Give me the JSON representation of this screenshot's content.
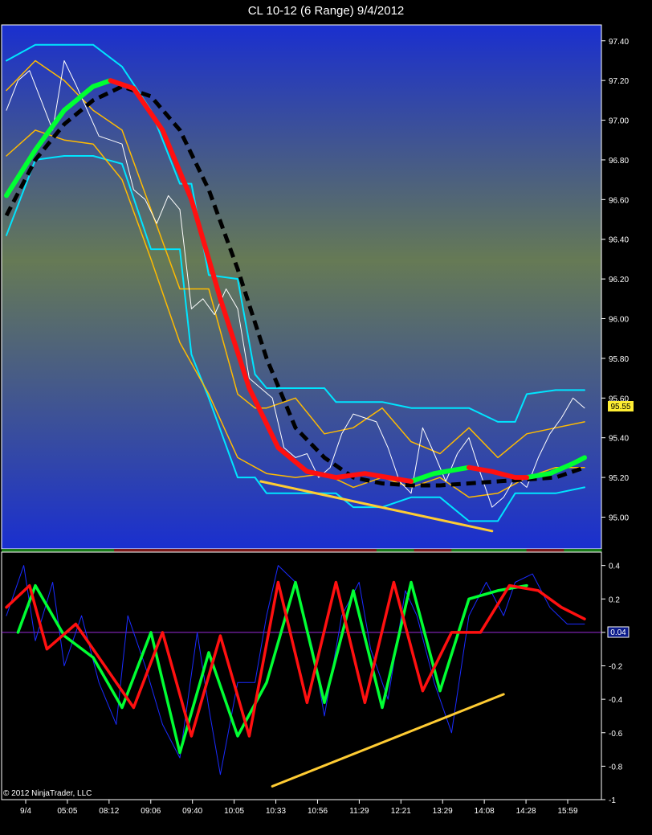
{
  "window": {
    "title": "CL 10-12 (6 Range)  9/4/2012",
    "copyright": "© 2012 NinjaTrader, LLC"
  },
  "chart_data": [
    {
      "type": "line",
      "name": "price-panel",
      "ylim": [
        94.84,
        97.48
      ],
      "y_ticks": [
        "97.40",
        "97.20",
        "97.00",
        "96.80",
        "96.60",
        "96.40",
        "96.20",
        "96.00",
        "95.80",
        "95.60",
        "95.40",
        "95.20",
        "95.00"
      ],
      "last_price_label": "95.55",
      "background": [
        "#1a2fcf",
        "#667a55",
        "#1a2fcf"
      ],
      "series": [
        {
          "color": "#ffffff",
          "role": "price",
          "x": [
            0,
            0.02,
            0.04,
            0.06,
            0.08,
            0.1,
            0.12,
            0.14,
            0.16,
            0.18,
            0.2,
            0.22,
            0.24,
            0.26,
            0.28,
            0.3,
            0.32,
            0.34,
            0.36,
            0.38,
            0.4,
            0.42,
            0.44,
            0.46,
            0.48,
            0.5,
            0.52,
            0.54,
            0.56,
            0.58,
            0.6,
            0.62,
            0.64,
            0.66,
            0.68,
            0.7,
            0.72,
            0.74,
            0.76,
            0.78,
            0.8,
            0.82,
            0.84,
            0.86,
            0.88,
            0.9,
            0.92,
            0.94,
            0.96,
            0.98,
            1
          ],
          "y": [
            97.05,
            97.2,
            97.25,
            97.1,
            96.95,
            97.3,
            97.18,
            97.05,
            96.92,
            96.9,
            96.88,
            96.65,
            96.6,
            96.48,
            96.62,
            96.55,
            96.05,
            96.1,
            96.02,
            96.15,
            96.05,
            95.7,
            95.65,
            95.6,
            95.35,
            95.3,
            95.32,
            95.2,
            95.25,
            95.42,
            95.52,
            95.5,
            95.48,
            95.35,
            95.18,
            95.12,
            95.45,
            95.32,
            95.18,
            95.32,
            95.4,
            95.22,
            95.05,
            95.1,
            95.2,
            95.15,
            95.3,
            95.42,
            95.5,
            95.6,
            95.55
          ]
        },
        {
          "color": "#00ff33",
          "role": "smooth-average-up",
          "x": [
            0,
            0.05,
            0.1,
            0.15,
            0.18
          ],
          "y": [
            96.62,
            96.85,
            97.05,
            97.17,
            97.2
          ]
        },
        {
          "color": "#ff1010",
          "role": "smooth-average-down",
          "x": [
            0.18,
            0.22,
            0.27,
            0.32,
            0.37,
            0.42,
            0.47,
            0.52,
            0.57,
            0.62,
            0.66,
            0.7
          ],
          "y": [
            97.2,
            97.16,
            96.95,
            96.6,
            96.1,
            95.65,
            95.35,
            95.23,
            95.2,
            95.22,
            95.2,
            95.18
          ]
        },
        {
          "color": "#00ff33",
          "role": "smooth-average-up",
          "x": [
            0.7,
            0.74,
            0.78,
            0.8
          ],
          "y": [
            95.18,
            95.22,
            95.24,
            95.25
          ]
        },
        {
          "color": "#ff1010",
          "role": "smooth-average-down",
          "x": [
            0.8,
            0.84,
            0.88,
            0.9
          ],
          "y": [
            95.25,
            95.23,
            95.2,
            95.2
          ]
        },
        {
          "color": "#00ff33",
          "role": "smooth-average-up",
          "x": [
            0.9,
            0.94,
            0.98,
            1
          ],
          "y": [
            95.2,
            95.22,
            95.27,
            95.3
          ]
        },
        {
          "color": "#000000",
          "role": "slow-average-dashed",
          "x": [
            0,
            0.05,
            0.1,
            0.15,
            0.2,
            0.25,
            0.3,
            0.35,
            0.4,
            0.45,
            0.5,
            0.55,
            0.6,
            0.65,
            0.7,
            0.75,
            0.8,
            0.85,
            0.9,
            0.95,
            1
          ],
          "y": [
            96.52,
            96.8,
            96.98,
            97.1,
            97.17,
            97.12,
            96.95,
            96.65,
            96.25,
            95.8,
            95.45,
            95.3,
            95.2,
            95.17,
            95.16,
            95.16,
            95.17,
            95.18,
            95.19,
            95.2,
            95.25
          ]
        },
        {
          "color": "#00e5ff",
          "role": "upper-channel",
          "x": [
            0,
            0.05,
            0.1,
            0.15,
            0.2,
            0.25,
            0.3,
            0.32,
            0.35,
            0.4,
            0.43,
            0.45,
            0.5,
            0.55,
            0.57,
            0.6,
            0.65,
            0.7,
            0.75,
            0.8,
            0.85,
            0.88,
            0.9,
            0.95,
            1
          ],
          "y": [
            97.3,
            97.38,
            97.38,
            97.38,
            97.27,
            97.05,
            96.68,
            96.68,
            96.22,
            96.2,
            95.72,
            95.65,
            95.65,
            95.65,
            95.58,
            95.58,
            95.58,
            95.55,
            95.55,
            95.55,
            95.48,
            95.48,
            95.62,
            95.64,
            95.64
          ]
        },
        {
          "color": "#00e5ff",
          "role": "lower-channel",
          "x": [
            0,
            0.05,
            0.1,
            0.15,
            0.2,
            0.25,
            0.3,
            0.32,
            0.35,
            0.4,
            0.43,
            0.45,
            0.5,
            0.55,
            0.57,
            0.6,
            0.65,
            0.7,
            0.75,
            0.8,
            0.85,
            0.88,
            0.9,
            0.95,
            1
          ],
          "y": [
            96.42,
            96.8,
            96.82,
            96.82,
            96.78,
            96.35,
            96.35,
            95.82,
            95.6,
            95.2,
            95.2,
            95.12,
            95.12,
            95.12,
            95.12,
            95.05,
            95.05,
            95.1,
            95.1,
            94.98,
            94.98,
            95.12,
            95.12,
            95.12,
            95.15
          ]
        },
        {
          "color": "#ffbb00",
          "role": "inner-upper",
          "x": [
            0,
            0.05,
            0.1,
            0.15,
            0.2,
            0.25,
            0.3,
            0.35,
            0.4,
            0.43,
            0.45,
            0.5,
            0.55,
            0.6,
            0.65,
            0.7,
            0.75,
            0.8,
            0.85,
            0.9,
            0.95,
            1
          ],
          "y": [
            97.15,
            97.3,
            97.2,
            97.05,
            96.95,
            96.55,
            96.15,
            96.15,
            95.62,
            95.55,
            95.55,
            95.6,
            95.42,
            95.45,
            95.55,
            95.38,
            95.32,
            95.45,
            95.3,
            95.42,
            95.45,
            95.48
          ]
        },
        {
          "color": "#ffbb00",
          "role": "inner-lower",
          "x": [
            0,
            0.05,
            0.1,
            0.15,
            0.2,
            0.25,
            0.3,
            0.35,
            0.4,
            0.45,
            0.5,
            0.55,
            0.6,
            0.65,
            0.7,
            0.75,
            0.8,
            0.85,
            0.9,
            0.95,
            1
          ],
          "y": [
            96.82,
            96.95,
            96.9,
            96.88,
            96.7,
            96.3,
            95.88,
            95.62,
            95.3,
            95.22,
            95.2,
            95.22,
            95.15,
            95.2,
            95.15,
            95.2,
            95.1,
            95.12,
            95.2,
            95.25,
            95.25
          ]
        },
        {
          "color": "#ffcc33",
          "role": "trend-line",
          "x": [
            0.44,
            0.84
          ],
          "y": [
            95.18,
            94.93
          ]
        }
      ]
    },
    {
      "type": "line",
      "name": "oscillator-panel",
      "ylim": [
        -1.0,
        0.48
      ],
      "y_ticks": [
        "0.4",
        "0.2",
        "0",
        "-0.2",
        "-0.4",
        "-0.6",
        "-0.8",
        "-1"
      ],
      "last_value_label": "0.04",
      "zero_line_color": "#9a2bd8",
      "series": [
        {
          "color": "#1a2bff",
          "role": "raw",
          "x": [
            0,
            0.03,
            0.05,
            0.08,
            0.1,
            0.13,
            0.16,
            0.19,
            0.21,
            0.24,
            0.27,
            0.3,
            0.33,
            0.35,
            0.37,
            0.4,
            0.43,
            0.45,
            0.47,
            0.5,
            0.53,
            0.55,
            0.58,
            0.61,
            0.63,
            0.66,
            0.69,
            0.71,
            0.74,
            0.77,
            0.8,
            0.83,
            0.86,
            0.88,
            0.91,
            0.94,
            0.97,
            1
          ],
          "y": [
            0.1,
            0.4,
            -0.05,
            0.3,
            -0.2,
            0.1,
            -0.3,
            -0.55,
            0.1,
            -0.2,
            -0.55,
            -0.75,
            0.0,
            -0.45,
            -0.85,
            -0.3,
            -0.3,
            0.1,
            0.4,
            0.3,
            -0.1,
            -0.5,
            0.1,
            0.3,
            -0.1,
            -0.4,
            0.25,
            0.1,
            -0.3,
            -0.6,
            0.1,
            0.3,
            0.1,
            0.3,
            0.35,
            0.15,
            0.05,
            0.05
          ]
        },
        {
          "color": "#00ff33",
          "role": "signal-up",
          "x": [
            0.02,
            0.05,
            0.1,
            0.15,
            0.2,
            0.25,
            0.3,
            0.35,
            0.4,
            0.45,
            0.5,
            0.55,
            0.6,
            0.65,
            0.7,
            0.75,
            0.8,
            0.85,
            0.9
          ],
          "y": [
            0.0,
            0.28,
            -0.02,
            -0.15,
            -0.45,
            0.0,
            -0.72,
            -0.12,
            -0.62,
            -0.3,
            0.3,
            -0.42,
            0.25,
            -0.45,
            0.3,
            -0.35,
            0.2,
            0.25,
            0.28
          ]
        },
        {
          "color": "#ff1010",
          "role": "signal-down",
          "x": [
            0,
            0.04,
            0.07,
            0.12,
            0.17,
            0.22,
            0.27,
            0.32,
            0.37,
            0.42,
            0.47,
            0.52,
            0.57,
            0.62,
            0.67,
            0.72,
            0.77,
            0.82,
            0.87,
            0.92,
            0.96,
            1
          ],
          "y": [
            0.15,
            0.28,
            -0.1,
            0.05,
            -0.2,
            -0.45,
            0.0,
            -0.62,
            -0.02,
            -0.62,
            0.3,
            -0.42,
            0.3,
            -0.42,
            0.3,
            -0.35,
            0.0,
            0.0,
            0.28,
            0.25,
            0.15,
            0.08
          ]
        },
        {
          "color": "#ffcc33",
          "role": "trend-line",
          "x": [
            0.46,
            0.86
          ],
          "y": [
            -0.92,
            -0.37
          ]
        }
      ]
    }
  ],
  "x_axis": {
    "ticks": [
      "9/4",
      "05:05",
      "08:12",
      "09:06",
      "09:40",
      "10:05",
      "10:33",
      "10:56",
      "11:29",
      "12:21",
      "13:29",
      "14:08",
      "14:28",
      "15:59"
    ]
  },
  "strip_colors": [
    "#1a7a1a",
    "#1a7a1a",
    "#1a7a1a",
    "#7a1a1a",
    "#7a1a1a",
    "#7a1a1a",
    "#7a1a1a",
    "#7a1a1a",
    "#7a1a1a",
    "#7a1a1a",
    "#1a7a1a",
    "#7a1a1a",
    "#1a7a1a",
    "#1a7a1a",
    "#7a1a1a",
    "#1a7a1a"
  ]
}
